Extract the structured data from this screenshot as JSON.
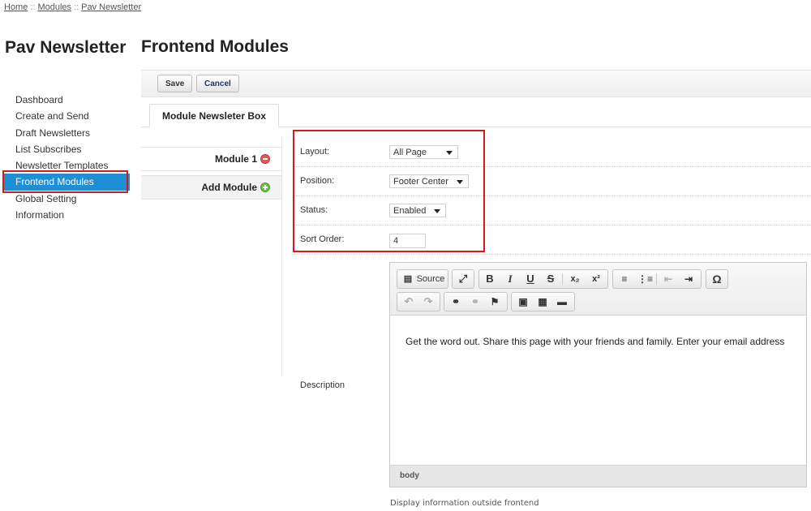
{
  "breadcrumb": {
    "items": [
      "Home",
      "Modules",
      "Pav Newsletter"
    ],
    "separator": "::"
  },
  "brand": {
    "title": "Pav Newsletter"
  },
  "sidebar": {
    "items": [
      {
        "label": "Dashboard"
      },
      {
        "label": "Create and Send"
      },
      {
        "label": "Draft Newsletters"
      },
      {
        "label": "List Subscribes"
      },
      {
        "label": "Newsletter Templates"
      },
      {
        "label": "Frontend Modules",
        "active": true
      },
      {
        "label": "Global Setting"
      },
      {
        "label": "Information"
      }
    ]
  },
  "page": {
    "title": "Frontend Modules"
  },
  "toolbar": {
    "save_label": "Save",
    "cancel_label": "Cancel"
  },
  "tabs": [
    {
      "label": "Module Newsleter Box",
      "active": true
    }
  ],
  "modules": {
    "module1_label": "Module 1",
    "add_label": "Add Module"
  },
  "form": {
    "layout": {
      "label": "Layout:",
      "value": "All Page"
    },
    "position": {
      "label": "Position:",
      "value": "Footer Center"
    },
    "status": {
      "label": "Status:",
      "value": "Enabled"
    },
    "sort_order": {
      "label": "Sort Order:",
      "value": "4"
    },
    "description": {
      "label": "Description"
    }
  },
  "editor": {
    "source_label": "Source",
    "content": "Get the word out. Share this page with your friends and family. Enter your email address",
    "path": "body"
  },
  "help_text": "Display information outside frontend",
  "colors": {
    "active_item": "#1e8fd4",
    "highlight_border": "#d11c1c"
  }
}
